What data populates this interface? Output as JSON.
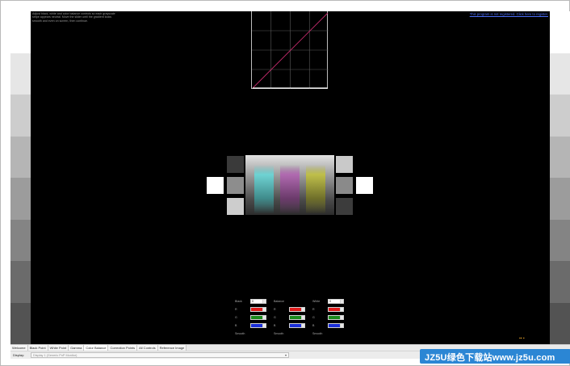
{
  "instructions": "Adjust black, white and color balance controls so each grayscale stripe appears neutral. Move the slider until the gradient looks smooth and even on screen, then continue.",
  "register_link": "This program is not registered. Click here to register.",
  "controls": {
    "groups": [
      {
        "label": "Black",
        "value": "0",
        "rows": [
          {
            "label": "R",
            "color": "#e01b1b"
          },
          {
            "label": "G",
            "color": "#1b8a1b"
          },
          {
            "label": "B",
            "color": "#1b2fd8"
          }
        ],
        "footer": "Smooth"
      },
      {
        "label": "Balance",
        "value": "",
        "rows": [
          {
            "label": "R",
            "color": "#e01b1b"
          },
          {
            "label": "G",
            "color": "#1b8a1b"
          },
          {
            "label": "B",
            "color": "#1b2fd8"
          }
        ],
        "footer": "Smooth"
      },
      {
        "label": "White",
        "value": "0",
        "rows": [
          {
            "label": "R",
            "color": "#e01b1b"
          },
          {
            "label": "G",
            "color": "#1b8a1b"
          },
          {
            "label": "B",
            "color": "#1b2fd8"
          }
        ],
        "footer": "Smooth"
      }
    ]
  },
  "tabs": [
    "Welcome",
    "Black Point",
    "White Point",
    "Gamma",
    "Color Balance",
    "Correction Points",
    "All Controls",
    "Reference Image"
  ],
  "display": {
    "label": "Display:",
    "selected": "Display 1 (Generic PnP Monitor)"
  },
  "watermark": "JZ5U绿色下载站www.jz5u.com",
  "colors": {
    "canvas": "#000000",
    "cyan_bar": "#6fd3d3",
    "magenta_bar": "#b06ab0",
    "yellow_bar": "#bfbf4a",
    "curve": "#c02a6a",
    "link": "#4a6cf4"
  },
  "gray_levels": [
    "#ffffff",
    "#e6e6e6",
    "#cdcdcd",
    "#b5b5b5",
    "#9c9c9c",
    "#848484",
    "#6b6b6b",
    "#535353"
  ]
}
